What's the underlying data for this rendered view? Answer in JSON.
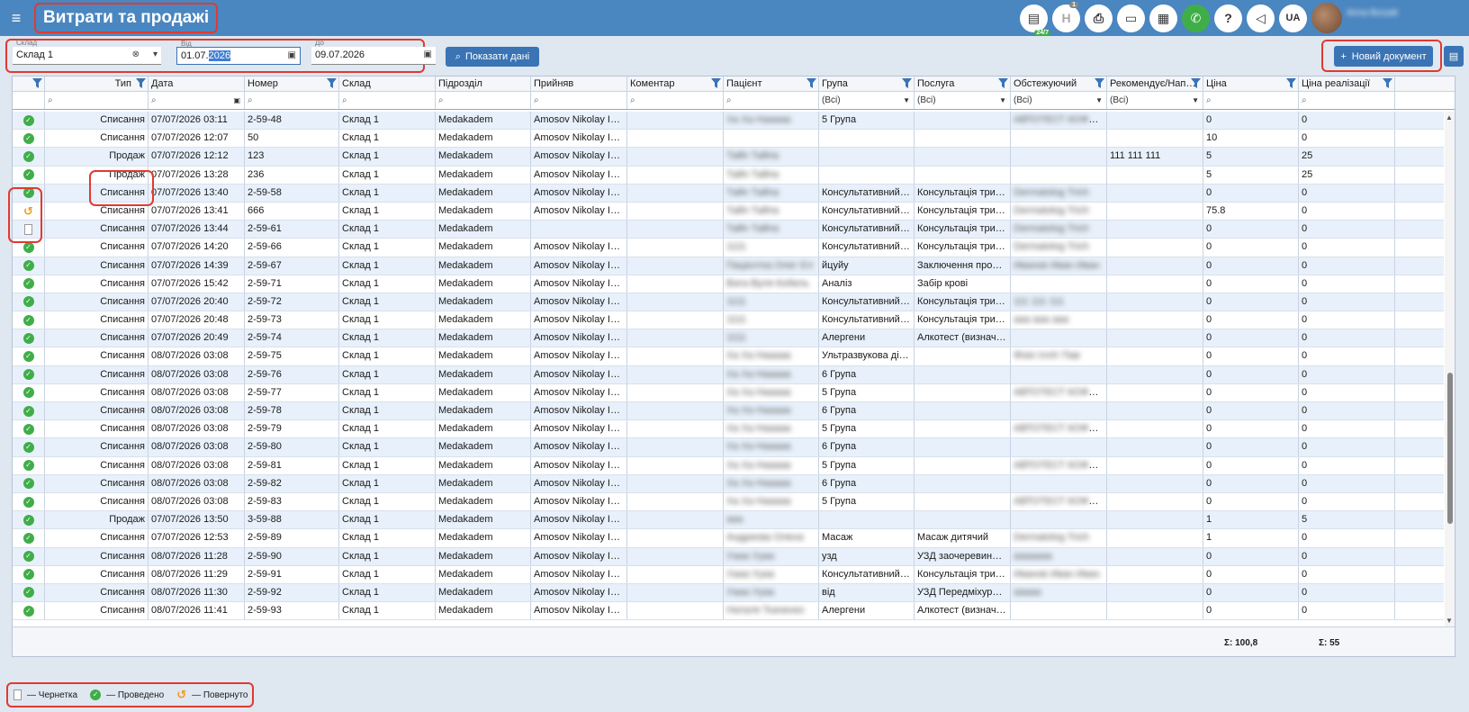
{
  "header": {
    "menu_icon": "hamburger-icon",
    "title": "Витрати та продажі",
    "chat_badge": "24/7",
    "notif_badge": "1",
    "lang": "UA",
    "user_name": "Anna Buryak",
    "icons": [
      "chat-icon",
      "h-icon",
      "pdf-icon",
      "card-icon",
      "calculator-icon",
      "phone-icon",
      "help-icon",
      "megaphone-icon"
    ]
  },
  "filters": {
    "warehouse_label": "Склад",
    "warehouse_value": "Склад 1",
    "from_label": "Від",
    "from_value_a": "01.07.",
    "from_value_b": "2026",
    "to_label": "До",
    "to_value": "09.07.2026",
    "show_button": "Показати дані",
    "new_doc_button": "Новий документ"
  },
  "columns": [
    "",
    "Тип",
    "Дата",
    "Номер",
    "Склад",
    "Підрозділ",
    "Прийняв",
    "Коментар",
    "Пацієнт",
    "Група",
    "Послуга",
    "Обстежуючий",
    "Рекомендує/Нап…",
    "Ціна",
    "Ціна реалізації"
  ],
  "filter_values": {
    "group": "(Всі)",
    "service": "(Всі)",
    "examiner": "(Всі)",
    "recommends": "(Всі)"
  },
  "rows": [
    {
      "status": "ok",
      "type": "Списання",
      "date": "07/07/2026 03:11",
      "num": "2-59-48",
      "wh": "Склад 1",
      "dept": "Medakadem",
      "acc": "Amosov Nikolay Iva...",
      "comm": "",
      "pat": "Ха Ха Нааааа",
      "grp": "5 Група",
      "srv": "",
      "exam": "АВТОТЕСТ КОФЕДА",
      "rec": "",
      "price": "0",
      "sale": "0"
    },
    {
      "status": "ok",
      "type": "Списання",
      "date": "07/07/2026 12:07",
      "num": "50",
      "wh": "Склад 1",
      "dept": "Medakadem",
      "acc": "Amosov Nikolay Iva...",
      "comm": "",
      "pat": "",
      "grp": "",
      "srv": "",
      "exam": "",
      "rec": "",
      "price": "10",
      "sale": "0"
    },
    {
      "status": "ok",
      "type": "Продаж",
      "date": "07/07/2026 12:12",
      "num": "123",
      "wh": "Склад 1",
      "dept": "Medakadem",
      "acc": "Amosov Nikolay Iva...",
      "comm": "",
      "pat": "Тайп Тайпа",
      "grp": "",
      "srv": "",
      "exam": "",
      "rec": "111 111 111",
      "price": "5",
      "sale": "25"
    },
    {
      "status": "ok",
      "type": "Продаж",
      "date": "07/07/2026 13:28",
      "num": "236",
      "wh": "Склад 1",
      "dept": "Medakadem",
      "acc": "Amosov Nikolay Iva...",
      "comm": "",
      "pat": "Тайп Тайпа",
      "grp": "",
      "srv": "",
      "exam": "",
      "rec": "",
      "price": "5",
      "sale": "25"
    },
    {
      "status": "ok",
      "type": "Списання",
      "date": "07/07/2026 13:40",
      "num": "2-59-58",
      "wh": "Склад 1",
      "dept": "Medakadem",
      "acc": "Amosov Nikolay Iva...",
      "comm": "",
      "pat": "Тайп Тайпа",
      "grp": "Консультативний п...",
      "srv": "Консультація трихо...",
      "exam": "Dermatolog Trich",
      "rec": "",
      "price": "0",
      "sale": "0"
    },
    {
      "status": "ret",
      "type": "Списання",
      "date": "07/07/2026 13:41",
      "num": "666",
      "wh": "Склад 1",
      "dept": "Medakadem",
      "acc": "Amosov Nikolay Iva...",
      "comm": "",
      "pat": "Тайп Тайпа",
      "grp": "Консультативний п...",
      "srv": "Консультація трихо...",
      "exam": "Dermatolog Trich",
      "rec": "",
      "price": "75.8",
      "sale": "0"
    },
    {
      "status": "draft",
      "type": "Списання",
      "date": "07/07/2026 13:44",
      "num": "2-59-61",
      "wh": "Склад 1",
      "dept": "Medakadem",
      "acc": "",
      "comm": "",
      "pat": "Тайп Тайпа",
      "grp": "Консультативний п...",
      "srv": "Консультація трихо...",
      "exam": "Dermatolog Trich",
      "rec": "",
      "price": "0",
      "sale": "0"
    },
    {
      "status": "ok",
      "type": "Списання",
      "date": "07/07/2026 14:20",
      "num": "2-59-66",
      "wh": "Склад 1",
      "dept": "Medakadem",
      "acc": "Amosov Nikolay Iva...",
      "comm": "",
      "pat": "1111",
      "grp": "Консультативний п...",
      "srv": "Консультація трихо...",
      "exam": "Dermatolog Trich",
      "rec": "",
      "price": "0",
      "sale": "0"
    },
    {
      "status": "ok",
      "type": "Списання",
      "date": "07/07/2026 14:39",
      "num": "2-59-67",
      "wh": "Склад 1",
      "dept": "Medakadem",
      "acc": "Amosov Nikolay Iva...",
      "comm": "",
      "pat": "Пацієнтка Олег Єл",
      "grp": "йцуйу",
      "srv": "Заключення профп...",
      "exam": "Иванов Иван Иван",
      "rec": "",
      "price": "0",
      "sale": "0"
    },
    {
      "status": "ok",
      "type": "Списання",
      "date": "07/07/2026 15:42",
      "num": "2-59-71",
      "wh": "Склад 1",
      "dept": "Medakadem",
      "acc": "Amosov Nikolay Iva...",
      "comm": "",
      "pat": "Вата Вуля Кобель",
      "grp": "Аналіз",
      "srv": "Забір крові",
      "exam": "",
      "rec": "",
      "price": "0",
      "sale": "0"
    },
    {
      "status": "ok",
      "type": "Списання",
      "date": "07/07/2026 20:40",
      "num": "2-59-72",
      "wh": "Склад 1",
      "dept": "Medakadem",
      "acc": "Amosov Nikolay Iva...",
      "comm": "",
      "pat": "1111",
      "grp": "Консультативний п...",
      "srv": "Консультація трихо...",
      "exam": "111 111 111",
      "rec": "",
      "price": "0",
      "sale": "0"
    },
    {
      "status": "ok",
      "type": "Списання",
      "date": "07/07/2026 20:48",
      "num": "2-59-73",
      "wh": "Склад 1",
      "dept": "Medakadem",
      "acc": "Amosov Nikolay Iva...",
      "comm": "",
      "pat": "1111",
      "grp": "Консультативний п...",
      "srv": "Консультація трихо...",
      "exam": "ааа ааа ааа",
      "rec": "",
      "price": "0",
      "sale": "0"
    },
    {
      "status": "ok",
      "type": "Списання",
      "date": "07/07/2026 20:49",
      "num": "2-59-74",
      "wh": "Склад 1",
      "dept": "Medakadem",
      "acc": "Amosov Nikolay Iva...",
      "comm": "",
      "pat": "1111",
      "grp": "Алергени",
      "srv": "Алкотест (визначен...",
      "exam": "",
      "rec": "",
      "price": "0",
      "sale": "0"
    },
    {
      "status": "ok",
      "type": "Списання",
      "date": "08/07/2026 03:08",
      "num": "2-59-75",
      "wh": "Склад 1",
      "dept": "Medakadem",
      "acc": "Amosov Nikolay Iva...",
      "comm": "",
      "pat": "Ха Ха Нааааа",
      "grp": "Ультразвукова діаг...",
      "srv": "",
      "exam": "Фізіо Ілліт Пав",
      "rec": "",
      "price": "0",
      "sale": "0"
    },
    {
      "status": "ok",
      "type": "Списання",
      "date": "08/07/2026 03:08",
      "num": "2-59-76",
      "wh": "Склад 1",
      "dept": "Medakadem",
      "acc": "Amosov Nikolay Iva...",
      "comm": "",
      "pat": "Ха Ха Нааааа",
      "grp": "6 Група",
      "srv": "",
      "exam": "",
      "rec": "",
      "price": "0",
      "sale": "0"
    },
    {
      "status": "ok",
      "type": "Списання",
      "date": "08/07/2026 03:08",
      "num": "2-59-77",
      "wh": "Склад 1",
      "dept": "Medakadem",
      "acc": "Amosov Nikolay Iva...",
      "comm": "",
      "pat": "Ха Ха Нааааа",
      "grp": "5 Група",
      "srv": "",
      "exam": "АВТОТЕСТ КОФЕДА",
      "rec": "",
      "price": "0",
      "sale": "0"
    },
    {
      "status": "ok",
      "type": "Списання",
      "date": "08/07/2026 03:08",
      "num": "2-59-78",
      "wh": "Склад 1",
      "dept": "Medakadem",
      "acc": "Amosov Nikolay Iva...",
      "comm": "",
      "pat": "Ха Ха Нааааа",
      "grp": "6 Група",
      "srv": "",
      "exam": "",
      "rec": "",
      "price": "0",
      "sale": "0"
    },
    {
      "status": "ok",
      "type": "Списання",
      "date": "08/07/2026 03:08",
      "num": "2-59-79",
      "wh": "Склад 1",
      "dept": "Medakadem",
      "acc": "Amosov Nikolay Iva...",
      "comm": "",
      "pat": "Ха Ха Нааааа",
      "grp": "5 Група",
      "srv": "",
      "exam": "АВТОТЕСТ КОФЕДА",
      "rec": "",
      "price": "0",
      "sale": "0"
    },
    {
      "status": "ok",
      "type": "Списання",
      "date": "08/07/2026 03:08",
      "num": "2-59-80",
      "wh": "Склад 1",
      "dept": "Medakadem",
      "acc": "Amosov Nikolay Iva...",
      "comm": "",
      "pat": "Ха Ха Нааааа",
      "grp": "6 Група",
      "srv": "",
      "exam": "",
      "rec": "",
      "price": "0",
      "sale": "0"
    },
    {
      "status": "ok",
      "type": "Списання",
      "date": "08/07/2026 03:08",
      "num": "2-59-81",
      "wh": "Склад 1",
      "dept": "Medakadem",
      "acc": "Amosov Nikolay Iva...",
      "comm": "",
      "pat": "Ха Ха Нааааа",
      "grp": "5 Група",
      "srv": "",
      "exam": "АВТОТЕСТ КОФЕДА",
      "rec": "",
      "price": "0",
      "sale": "0"
    },
    {
      "status": "ok",
      "type": "Списання",
      "date": "08/07/2026 03:08",
      "num": "2-59-82",
      "wh": "Склад 1",
      "dept": "Medakadem",
      "acc": "Amosov Nikolay Iva...",
      "comm": "",
      "pat": "Ха Ха Нааааа",
      "grp": "6 Група",
      "srv": "",
      "exam": "",
      "rec": "",
      "price": "0",
      "sale": "0"
    },
    {
      "status": "ok",
      "type": "Списання",
      "date": "08/07/2026 03:08",
      "num": "2-59-83",
      "wh": "Склад 1",
      "dept": "Medakadem",
      "acc": "Amosov Nikolay Iva...",
      "comm": "",
      "pat": "Ха Ха Нааааа",
      "grp": "5 Група",
      "srv": "",
      "exam": "АВТОТЕСТ КОФЕДА",
      "rec": "",
      "price": "0",
      "sale": "0"
    },
    {
      "status": "ok",
      "type": "Продаж",
      "date": "07/07/2026 13:50",
      "num": "3-59-88",
      "wh": "Склад 1",
      "dept": "Medakadem",
      "acc": "Amosov Nikolay Iva...",
      "comm": "",
      "pat": "ааа",
      "grp": "",
      "srv": "",
      "exam": "",
      "rec": "",
      "price": "1",
      "sale": "5"
    },
    {
      "status": "ok",
      "type": "Списання",
      "date": "07/07/2026 12:53",
      "num": "2-59-89",
      "wh": "Склад 1",
      "dept": "Medakadem",
      "acc": "Amosov Nikolay Iva...",
      "comm": "",
      "pat": "Андреєва Олена",
      "grp": "Масаж",
      "srv": "Масаж дитячий",
      "exam": "Dermatolog Trich",
      "rec": "",
      "price": "1",
      "sale": "0"
    },
    {
      "status": "ok",
      "type": "Списання",
      "date": "08/07/2026 11:28",
      "num": "2-59-90",
      "wh": "Склад 1",
      "dept": "Medakadem",
      "acc": "Amosov Nikolay Iva...",
      "comm": "",
      "pat": "Уааа Ууаа",
      "grp": "узд",
      "srv": "УЗД заочеревинних...",
      "exam": "ааааааа",
      "rec": "",
      "price": "0",
      "sale": "0"
    },
    {
      "status": "ok",
      "type": "Списання",
      "date": "08/07/2026 11:29",
      "num": "2-59-91",
      "wh": "Склад 1",
      "dept": "Medakadem",
      "acc": "Amosov Nikolay Iva...",
      "comm": "",
      "pat": "Уааа Ууаа",
      "grp": "Консультативний п...",
      "srv": "Консультація трихо...",
      "exam": "Иванов Иван Иван",
      "rec": "",
      "price": "0",
      "sale": "0"
    },
    {
      "status": "ok",
      "type": "Списання",
      "date": "08/07/2026 11:30",
      "num": "2-59-92",
      "wh": "Склад 1",
      "dept": "Medakadem",
      "acc": "Amosov Nikolay Iva...",
      "comm": "",
      "pat": "Уааа Ууаа",
      "grp": "від",
      "srv": "УЗД Передміхурово...",
      "exam": "ааааа",
      "rec": "",
      "price": "0",
      "sale": "0"
    },
    {
      "status": "ok",
      "type": "Списання",
      "date": "08/07/2026 11:41",
      "num": "2-59-93",
      "wh": "Склад 1",
      "dept": "Medakadem",
      "acc": "Amosov Nikolay Iva...",
      "comm": "",
      "pat": "Наталя Ткаченко",
      "grp": "Алергени",
      "srv": "Алкотест (визначен...",
      "exam": "",
      "rec": "",
      "price": "0",
      "sale": "0"
    }
  ],
  "totals": {
    "price": "Σ: 100,8",
    "sale": "Σ: 55"
  },
  "legend": {
    "draft": "— Чернетка",
    "done": "— Проведено",
    "returned": "— Повернуто"
  },
  "colors": {
    "topbar": "#4a86c0",
    "accent": "#3a74b4",
    "ok": "#3fae49",
    "returned": "#f39a1e",
    "highlight": "#e03a2f"
  }
}
